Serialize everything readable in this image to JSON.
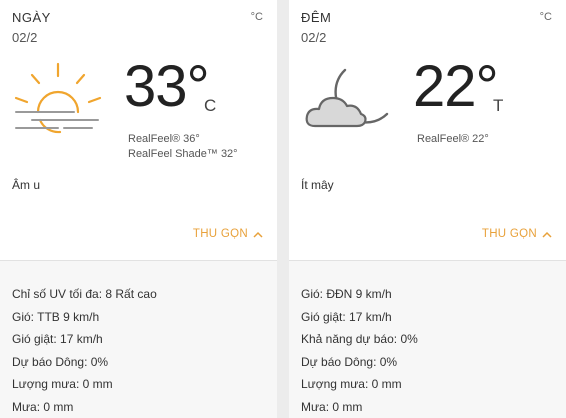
{
  "day": {
    "period": "NGÀY",
    "date": "02/2",
    "unit": "°C",
    "icon": "hazy-sun-icon",
    "temperature": "33°",
    "temp_unit_letter": "C",
    "realfeel": "RealFeel® 36°",
    "realfeel_shade": "RealFeel Shade™ 32°",
    "phrase": "Âm u",
    "collapse_label": "THU GỌN",
    "details": [
      "Chỉ số UV tối đa: 8 Rất cao",
      "Gió: TTB 9 km/h",
      "Gió giật: 17 km/h",
      "Dự báo Dông: 0%",
      "Lượng mưa: 0 mm",
      "Mưa: 0 mm"
    ]
  },
  "night": {
    "period": "ĐÊM",
    "date": "02/2",
    "unit": "°C",
    "icon": "moon-cloud-icon",
    "temperature": "22°",
    "temp_unit_letter": "T",
    "realfeel": "RealFeel® 22°",
    "phrase": "Ít mây",
    "collapse_label": "THU GỌN",
    "details": [
      "Gió: ĐĐN 9 km/h",
      "Gió giật: 17 km/h",
      "Khả năng dự báo: 0%",
      "Dự báo Dông: 0%",
      "Lượng mưa: 0 mm",
      "Mưa: 0 mm"
    ]
  },
  "colors": {
    "accent": "#e8a13a",
    "sun": "#f0a52e",
    "haze": "#9a9a9a",
    "moon_stroke": "#666666",
    "cloud_fill": "#d8d8d8"
  }
}
